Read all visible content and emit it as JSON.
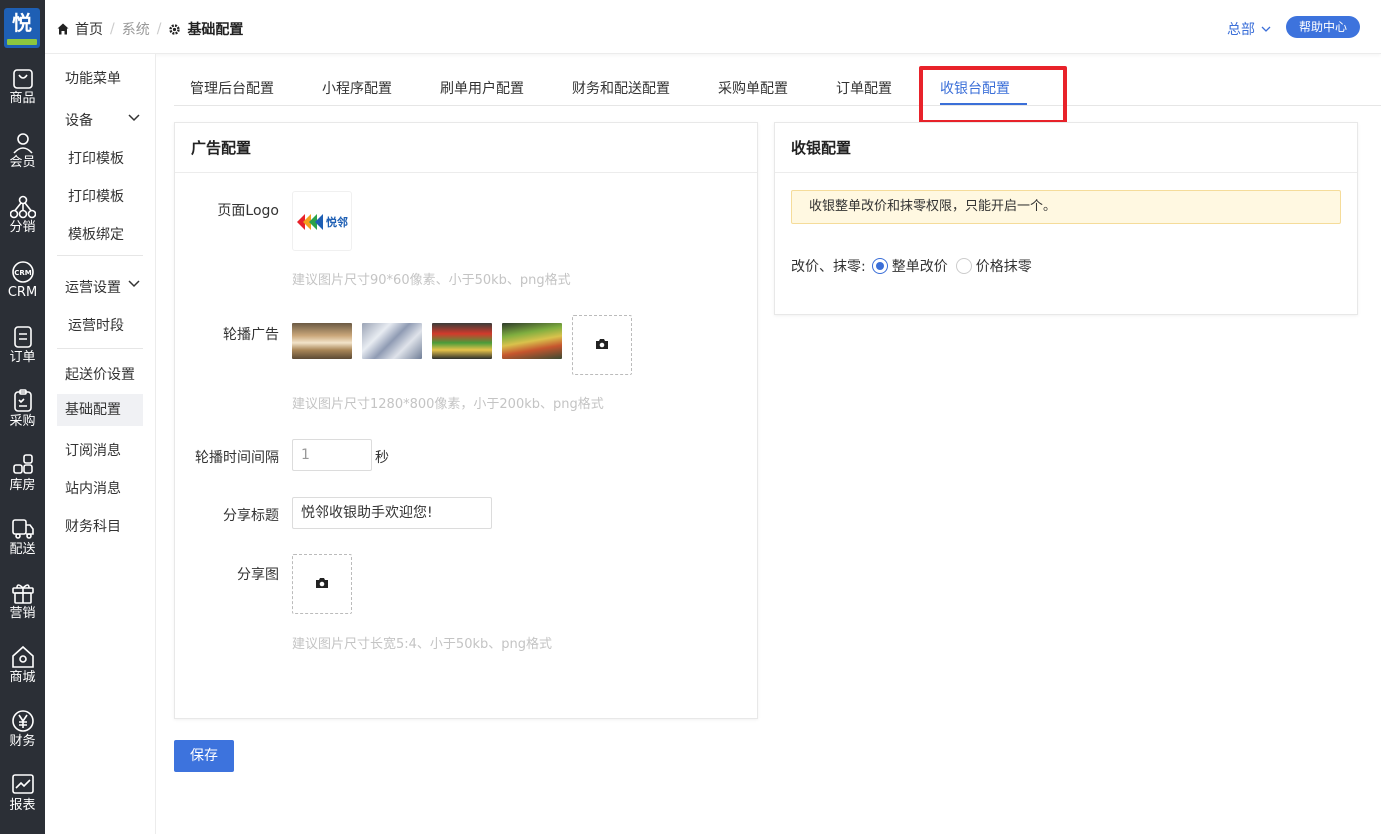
{
  "rail": {
    "logo_glyph": "悦",
    "items": [
      {
        "label": "商品",
        "icon": "bag-icon"
      },
      {
        "label": "会员",
        "icon": "user-icon"
      },
      {
        "label": "分销",
        "icon": "network-icon"
      },
      {
        "label": "CRM",
        "icon": "crm-icon"
      },
      {
        "label": "订单",
        "icon": "order-icon"
      },
      {
        "label": "采购",
        "icon": "clipboard-icon"
      },
      {
        "label": "库房",
        "icon": "warehouse-icon"
      },
      {
        "label": "配送",
        "icon": "truck-icon"
      },
      {
        "label": "营销",
        "icon": "gift-icon"
      },
      {
        "label": "商城",
        "icon": "store-icon"
      },
      {
        "label": "财务",
        "icon": "yen-icon"
      },
      {
        "label": "报表",
        "icon": "chart-icon"
      }
    ]
  },
  "topbar": {
    "breadcrumb": [
      "首页",
      "系统",
      "基础配置"
    ],
    "dept": "总部",
    "help": "帮助中心"
  },
  "subnav": {
    "items": [
      "功能菜单",
      "设备",
      "打印模板",
      "打印模板",
      "模板绑定",
      "运营设置",
      "运营时段",
      "起送价设置",
      "基础配置",
      "订阅消息",
      "站内消息",
      "财务科目"
    ]
  },
  "tabs": [
    "管理后台配置",
    "小程序配置",
    "刷单用户配置",
    "财务和配送配置",
    "采购单配置",
    "订单配置",
    "收银台配置"
  ],
  "ad_config": {
    "title": "广告配置",
    "logo_label": "页面Logo",
    "logo_text": "悦邻",
    "logo_hint": "建议图片尺寸90*60像素、小于50kb、png格式",
    "carousel_label": "轮播广告",
    "carousel_hint": "建议图片尺寸1280*800像素，小于200kb、png格式",
    "interval_label": "轮播时间间隔",
    "interval_value": "1",
    "interval_unit": "秒",
    "share_title_label": "分享标题",
    "share_title_value": "悦邻收银助手欢迎您!",
    "share_image_label": "分享图",
    "share_image_hint": "建议图片尺寸长宽5:4、小于50kb、png格式"
  },
  "cash_config": {
    "title": "收银配置",
    "notice": "收银整单改价和抹零权限，只能开启一个。",
    "radio_label": "改价、抹零:",
    "options": [
      "整单改价",
      "价格抹零"
    ],
    "selected": "整单改价"
  },
  "save_label": "保存",
  "colors": {
    "accent": "#3b6fd8",
    "highlight": "#e8222a",
    "rail": "#2b2f36"
  }
}
